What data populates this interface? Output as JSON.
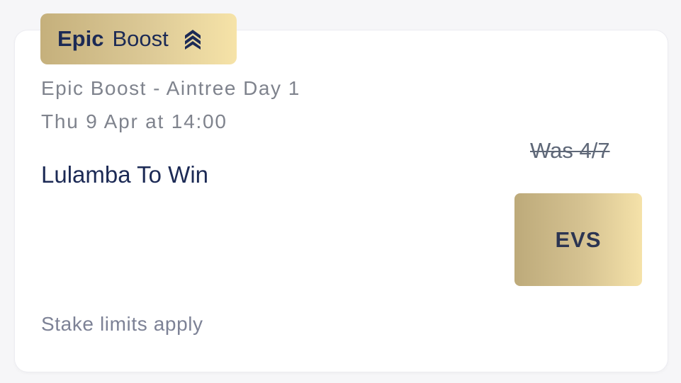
{
  "badge": {
    "strong_label": "Epic",
    "light_label": "Boost",
    "icon": "boost-chevrons-icon",
    "gradient_start": "#c5b07c",
    "gradient_end": "#f6e3a8"
  },
  "event": {
    "title": "Epic Boost - Aintree Day 1",
    "datetime": "Thu 9 Apr at 14:00",
    "selection": "Lulamba To Win"
  },
  "odds": {
    "was_label": "Was 4/7",
    "boosted_price": "EVS"
  },
  "footer": {
    "note": "Stake limits apply"
  },
  "colors": {
    "navy_text": "#1c2a55",
    "muted_text": "#7f838d",
    "card_background": "#ffffff"
  }
}
